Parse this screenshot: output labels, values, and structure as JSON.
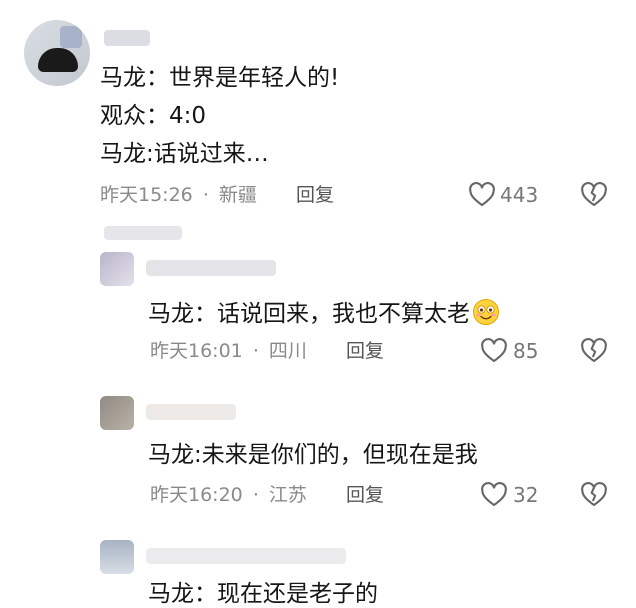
{
  "comments": [
    {
      "lines": [
        "马龙：世界是年轻人的!",
        "观众：4:0",
        "马龙:话说过来…"
      ],
      "time": "昨天15:26",
      "sep": "·",
      "location": "新疆",
      "reply_label": "回复",
      "likes": "443"
    },
    {
      "lines": [
        "马龙：话说回来，我也不算太老"
      ],
      "emoji": "smiling-face-emoji",
      "time": "昨天16:01",
      "sep": "·",
      "location": "四川",
      "reply_label": "回复",
      "likes": "85"
    },
    {
      "lines": [
        "马龙:未来是你们的，但现在是我"
      ],
      "time": "昨天16:20",
      "sep": "·",
      "location": "江苏",
      "reply_label": "回复",
      "likes": "32"
    },
    {
      "lines": [
        "马龙：现在还是老子的"
      ]
    }
  ],
  "icons": {
    "like": "heart-outline-icon",
    "dislike": "broken-heart-icon"
  },
  "colors": {
    "text": "#161616",
    "meta": "#8a8a8a",
    "icon": "#666666"
  }
}
